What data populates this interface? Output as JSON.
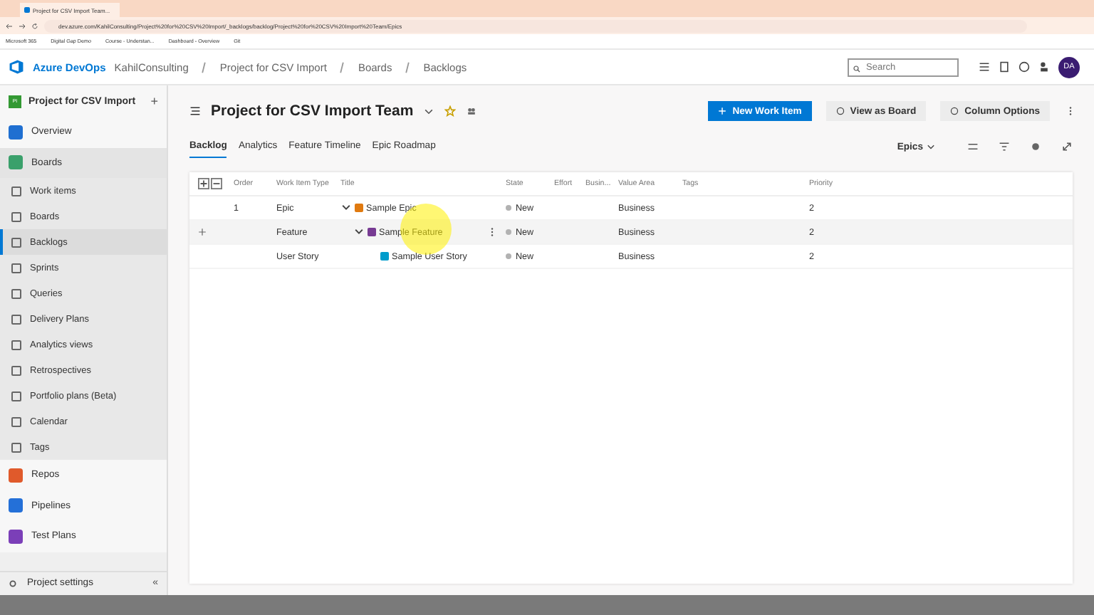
{
  "browser": {
    "tab_title": "Project for CSV Import Team...",
    "url": "dev.azure.com/KahilConsulting/Project%20for%20CSV%20Import/_backlogs/backlog/Project%20for%20CSV%20Import%20Team/Epics",
    "bookmarks": [
      "Microsoft 365",
      "Digital Gap Demo",
      "Course - Understan...",
      "Dashboard - Overview",
      "Git"
    ]
  },
  "header": {
    "product": "Azure DevOps",
    "breadcrumbs": [
      "KahilConsulting",
      "Project for CSV Import",
      "Boards",
      "Backlogs"
    ],
    "search": {
      "placeholder": "Search"
    },
    "avatar": "DA"
  },
  "sidebar": {
    "project": {
      "badge": "PI",
      "name": "Project for CSV Import",
      "add": "+"
    },
    "items": [
      {
        "label": "Overview",
        "kind": "overview",
        "selected": false
      },
      {
        "label": "Boards",
        "kind": "boards",
        "selected": false,
        "expanded": true,
        "children": [
          {
            "label": "Work items",
            "selected": false
          },
          {
            "label": "Boards",
            "selected": false
          },
          {
            "label": "Backlogs",
            "selected": true
          },
          {
            "label": "Sprints",
            "selected": false
          },
          {
            "label": "Queries",
            "selected": false
          },
          {
            "label": "Delivery Plans",
            "selected": false
          },
          {
            "label": "Analytics views",
            "selected": false
          },
          {
            "label": "Retrospectives",
            "selected": false
          },
          {
            "label": "Portfolio plans (Beta)",
            "selected": false
          },
          {
            "label": "Calendar",
            "selected": false
          },
          {
            "label": "Tags",
            "selected": false
          }
        ]
      },
      {
        "label": "Repos",
        "kind": "repos",
        "selected": false
      },
      {
        "label": "Pipelines",
        "kind": "pipelines",
        "selected": false
      },
      {
        "label": "Test Plans",
        "kind": "testplans",
        "selected": false
      }
    ],
    "footer": {
      "label": "Project settings",
      "collapse": "«"
    }
  },
  "page": {
    "title": "Project for CSV Import Team",
    "buttons": [
      {
        "label": "New Work Item",
        "kind": "primary"
      },
      {
        "label": "View as Board",
        "kind": "secondary"
      },
      {
        "label": "Column Options",
        "kind": "secondary"
      }
    ],
    "tabs": [
      {
        "label": "Backlog",
        "selected": true
      },
      {
        "label": "Analytics",
        "selected": false
      },
      {
        "label": "Feature Timeline",
        "selected": false
      },
      {
        "label": "Epic Roadmap",
        "selected": false
      }
    ],
    "level_picker": "Epics"
  },
  "table": {
    "columns": [
      "Order",
      "Work Item Type",
      "Title",
      "State",
      "Effort",
      "Busin...",
      "Value Area",
      "Tags",
      "Priority"
    ],
    "rows": [
      {
        "order": "1",
        "type": "Epic",
        "kind": "epic",
        "title": "Sample Epic",
        "state": "New",
        "value_area": "Business",
        "priority": "2",
        "expanded": true,
        "hovered": false,
        "children": [
          {
            "type": "Feature",
            "kind": "feature",
            "title": "Sample Feature",
            "state": "New",
            "value_area": "Business",
            "priority": "2",
            "expanded": true,
            "hovered": true,
            "children": [
              {
                "type": "User Story",
                "kind": "story",
                "title": "Sample User Story",
                "state": "New",
                "value_area": "Business",
                "priority": "2",
                "hovered": false
              }
            ]
          }
        ]
      }
    ]
  }
}
